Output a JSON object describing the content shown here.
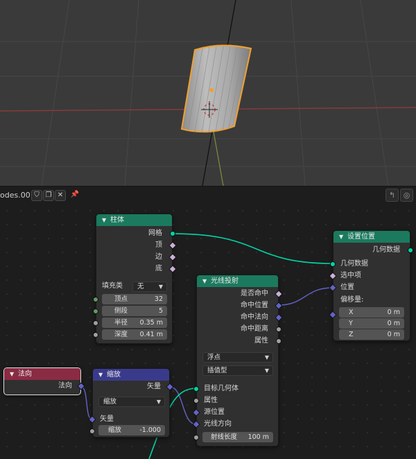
{
  "header": {
    "tree_name": "odes.001",
    "shield_icon": "shield-icon",
    "copy_icon": "copy-icon",
    "close_icon": "close-icon",
    "pin_icon": "pin-icon",
    "right_icons": [
      "parent-node-icon",
      "overlay-icon"
    ]
  },
  "nodes": {
    "cylinder": {
      "title": "柱体",
      "outputs": [
        "网格",
        "顶",
        "边",
        "底"
      ],
      "fill_label": "填充类",
      "fill_value": "无",
      "fields": [
        {
          "label": "顶点",
          "value": "32"
        },
        {
          "label": "侧段",
          "value": "5"
        },
        {
          "label": "半径",
          "value": "0.35 m"
        },
        {
          "label": "深度",
          "value": "0.41 m"
        }
      ]
    },
    "setpos": {
      "title": "设置位置",
      "output": "几何数据",
      "inputs": [
        "几何数据",
        "选中项",
        "位置"
      ],
      "offset_label": "偏移量:",
      "offset": [
        {
          "label": "X",
          "value": "0 m"
        },
        {
          "label": "Y",
          "value": "0 m"
        },
        {
          "label": "Z",
          "value": "0 m"
        }
      ]
    },
    "raycast": {
      "title": "光线投射",
      "outputs": [
        "是否命中",
        "命中位置",
        "命中法向",
        "命中距离",
        "属性"
      ],
      "dropdown1": "浮点",
      "dropdown2": "插值型",
      "inputs": [
        "目标几何体",
        "属性",
        "源位置",
        "光线方向"
      ],
      "ray_length_label": "射线长度",
      "ray_length_value": "100 m"
    },
    "normal": {
      "title": "法向",
      "output": "法向"
    },
    "scale": {
      "title": "缩放",
      "output": "矢量",
      "mode": "缩放",
      "input": "矢量",
      "factor_label": "缩放",
      "factor_value": "-1.000"
    }
  },
  "colors": {
    "geometry_header": "#1b7a5e",
    "vector_header": "#3a3a8c",
    "input_header": "#8a2b44",
    "geometry_socket": "#00d6a3",
    "vector_socket": "#6363c7",
    "object_outline": "#f0a030"
  }
}
